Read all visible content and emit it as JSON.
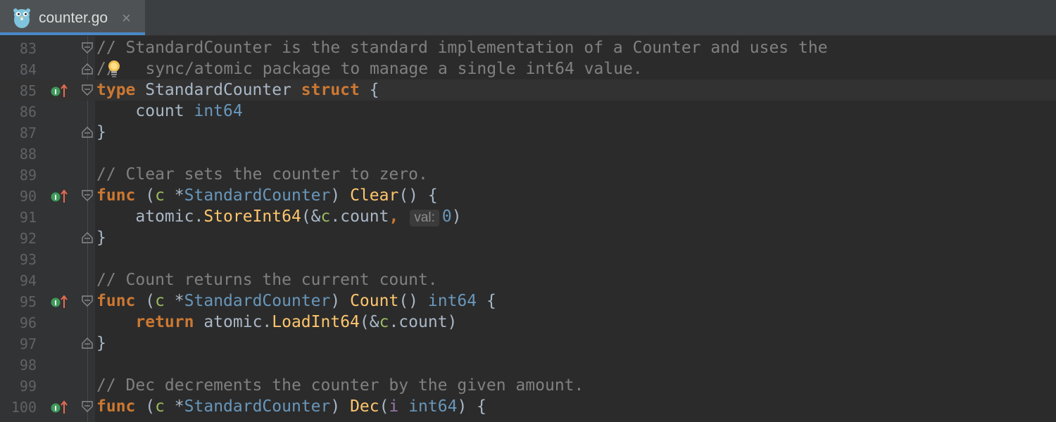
{
  "tab": {
    "title": "counter.go",
    "close": "×"
  },
  "lines": [
    {
      "n": "83"
    },
    {
      "n": "84"
    },
    {
      "n": "85"
    },
    {
      "n": "86"
    },
    {
      "n": "87"
    },
    {
      "n": "88"
    },
    {
      "n": "89"
    },
    {
      "n": "90"
    },
    {
      "n": "91"
    },
    {
      "n": "92"
    },
    {
      "n": "93"
    },
    {
      "n": "94"
    },
    {
      "n": "95"
    },
    {
      "n": "96"
    },
    {
      "n": "97"
    },
    {
      "n": "98"
    },
    {
      "n": "99"
    },
    {
      "n": "100"
    }
  ],
  "code": {
    "l83": "// StandardCounter is the standard implementation of a Counter and uses the",
    "l84a": "//",
    "l84b": " sync/atomic package to manage a single int64 value.",
    "l85_type": "type",
    "l85_name": " StandardCounter ",
    "l85_struct": "struct",
    "l85_brace": " {",
    "l86_field": "    count ",
    "l86_type": "int64",
    "l87": "}",
    "l89": "// Clear sets the counter to zero.",
    "l90_func": "func",
    "l90_open": " (",
    "l90_recv": "c",
    "l90_star": " *",
    "l90_type": "StandardCounter",
    "l90_close": ") ",
    "l90_name": "Clear",
    "l90_rest": "() {",
    "l91_pkg": "    atomic.",
    "l91_fn": "StoreInt64",
    "l91_a": "(&",
    "l91_c": "c",
    "l91_b": ".count",
    "l91_comma": ",",
    "l91_hint": "val:",
    "l91_num": "0",
    "l91_end": ")",
    "l92": "}",
    "l94": "// Count returns the current count.",
    "l95_func": "func",
    "l95_open": " (",
    "l95_recv": "c",
    "l95_star": " *",
    "l95_type": "StandardCounter",
    "l95_close": ") ",
    "l95_name": "Count",
    "l95_paren": "() ",
    "l95_ret": "int64",
    "l95_brace": " {",
    "l96_ret": "return",
    "l96_pkg": " atomic.",
    "l96_fn": "LoadInt64",
    "l96_a": "(&",
    "l96_c": "c",
    "l96_b": ".count)",
    "l97": "}",
    "l99": "// Dec decrements the counter by the given amount.",
    "l100_func": "func",
    "l100_open": " (",
    "l100_recv": "c",
    "l100_star": " *",
    "l100_type": "StandardCounter",
    "l100_close": ") ",
    "l100_name": "Dec",
    "l100_p": "(",
    "l100_param": "i",
    "l100_sp": " ",
    "l100_ptype": "int64",
    "l100_end": ") {"
  },
  "colors": {
    "background": "#2b2b2b",
    "keyword": "#cc7832",
    "comment": "#808080",
    "function": "#ffc66d",
    "type": "#6897bb",
    "receiver": "#9aba5f",
    "parameter": "#9876aa",
    "tab_accent": "#4a88c7"
  },
  "icons": {
    "file": "gopher-icon",
    "implements_marker": "implements-interface-icon",
    "intention": "lightbulb-icon"
  }
}
